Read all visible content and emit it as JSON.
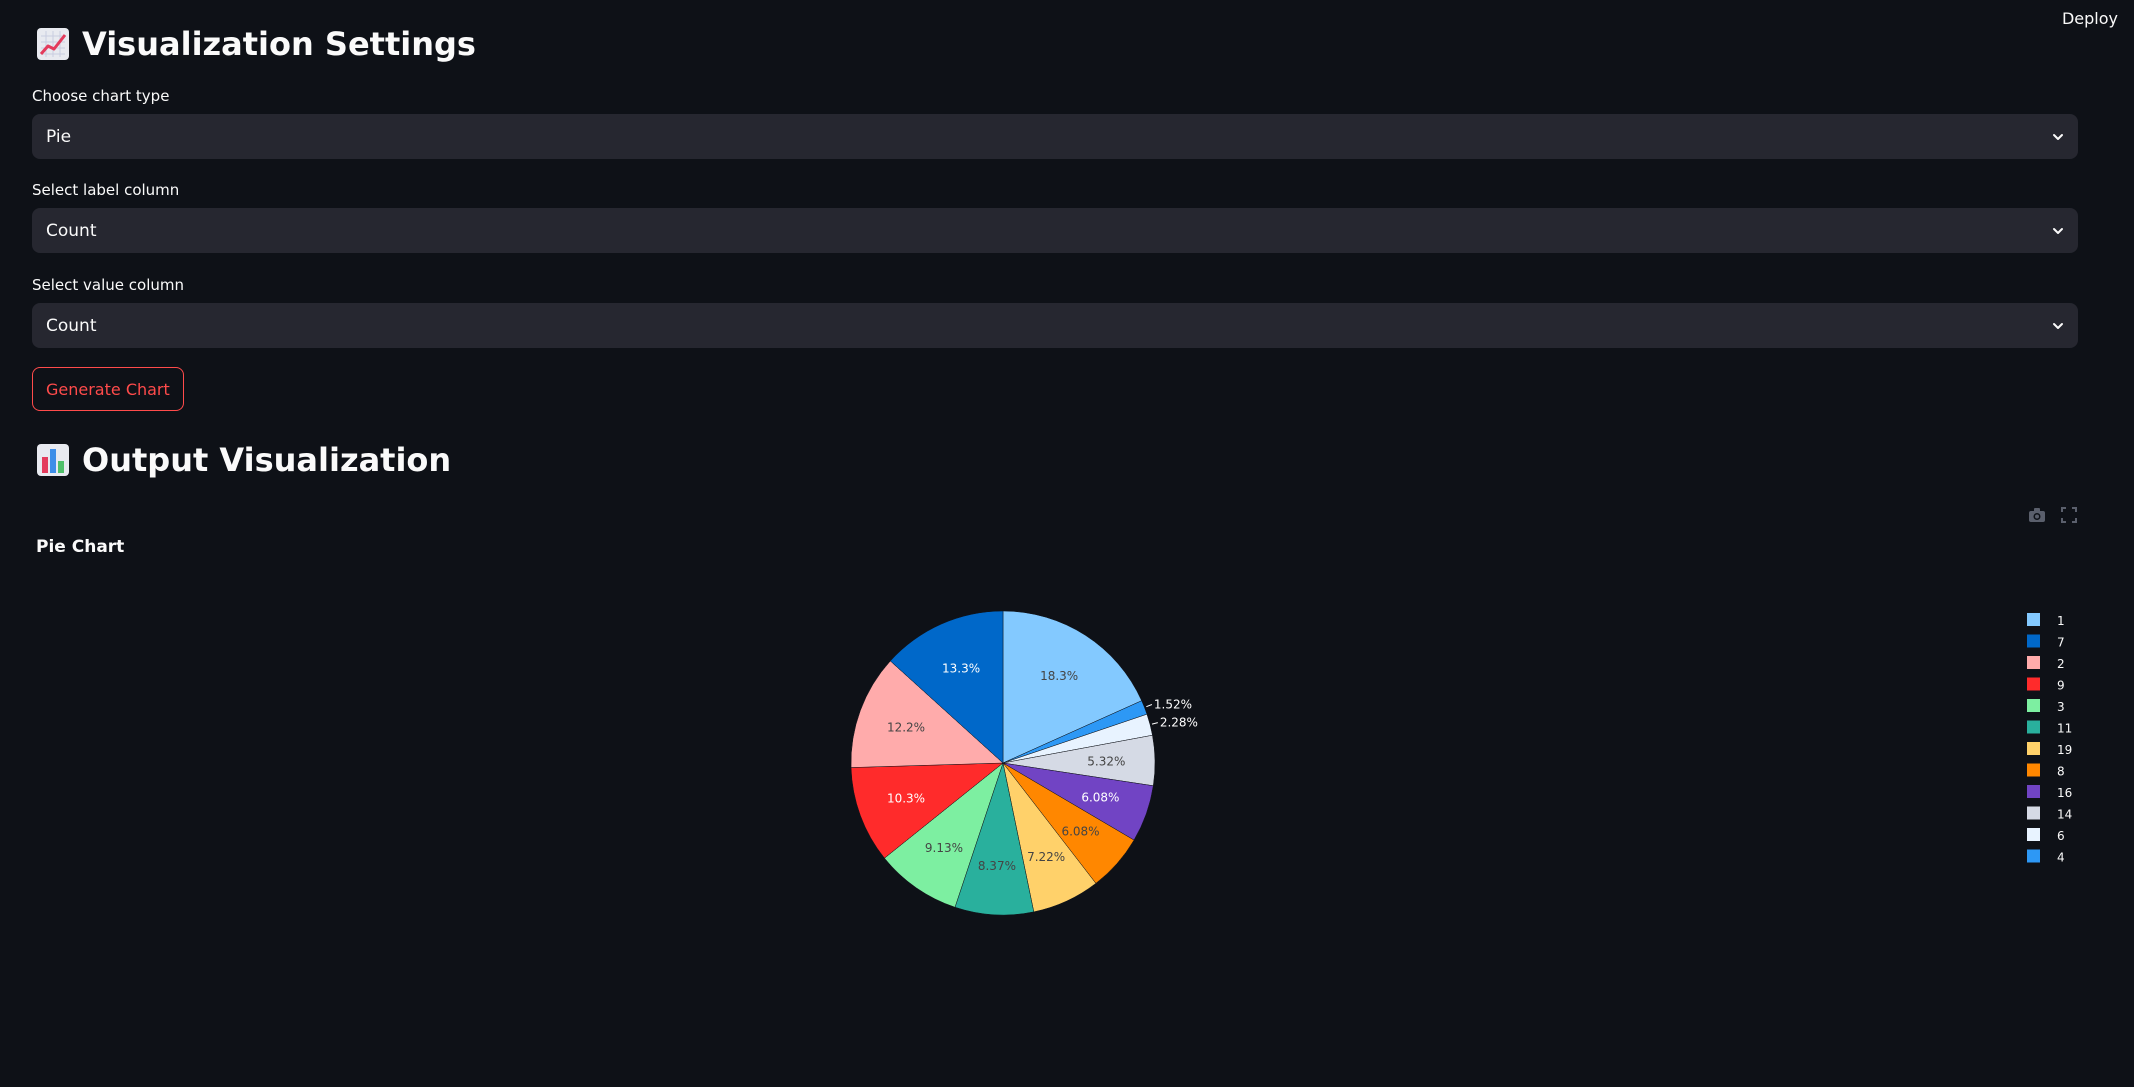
{
  "header": {
    "deploy_label": "Deploy"
  },
  "settings": {
    "heading": "Visualization Settings",
    "heading_icon": "chart-increasing-icon",
    "chart_type": {
      "label": "Choose chart type",
      "value": "Pie"
    },
    "label_column": {
      "label": "Select label column",
      "value": "Count"
    },
    "value_column": {
      "label": "Select value column",
      "value": "Count"
    },
    "generate_label": "Generate Chart"
  },
  "output": {
    "heading": "Output Visualization",
    "heading_icon": "bar-chart-icon",
    "modebar": [
      "camera-icon",
      "fullscreen-icon"
    ]
  },
  "chart_data": {
    "type": "pie",
    "title": "Pie Chart",
    "slices": [
      {
        "label": "1",
        "percent": 18.3,
        "text": "18.3%",
        "color": "#83c9ff",
        "text_color": "#444444"
      },
      {
        "label": "4",
        "percent": 1.52,
        "text": "1.52%",
        "color": "#2d98f5",
        "text_color": "#ffffff",
        "outside": true
      },
      {
        "label": "6",
        "percent": 2.28,
        "text": "2.28%",
        "color": "#e8f3ff",
        "text_color": "#ffffff",
        "outside": true
      },
      {
        "label": "14",
        "percent": 5.32,
        "text": "5.32%",
        "color": "#d5dae5",
        "text_color": "#444444"
      },
      {
        "label": "16",
        "percent": 6.08,
        "text": "6.08%",
        "color": "#7144c4",
        "text_color": "#ffffff"
      },
      {
        "label": "8",
        "percent": 6.08,
        "text": "6.08%",
        "color": "#ff8700",
        "text_color": "#444444"
      },
      {
        "label": "19",
        "percent": 7.22,
        "text": "7.22%",
        "color": "#ffd16a",
        "text_color": "#444444"
      },
      {
        "label": "11",
        "percent": 8.37,
        "text": "8.37%",
        "color": "#29b09d",
        "text_color": "#444444"
      },
      {
        "label": "3",
        "percent": 9.13,
        "text": "9.13%",
        "color": "#7defa1",
        "text_color": "#444444"
      },
      {
        "label": "9",
        "percent": 10.3,
        "text": "10.3%",
        "color": "#ff2b2b",
        "text_color": "#ffffff"
      },
      {
        "label": "2",
        "percent": 12.2,
        "text": "12.2%",
        "color": "#ffabab",
        "text_color": "#444444"
      },
      {
        "label": "7",
        "percent": 13.3,
        "text": "13.3%",
        "color": "#0068c9",
        "text_color": "#ffffff"
      }
    ],
    "legend_order": [
      "1",
      "7",
      "2",
      "9",
      "3",
      "11",
      "19",
      "8",
      "16",
      "14",
      "6",
      "4"
    ],
    "legend_position": "right"
  },
  "colors": {
    "background": "#0e1117",
    "widget": "#262730",
    "accent": "#ff4b4b",
    "text": "#fafafa"
  }
}
